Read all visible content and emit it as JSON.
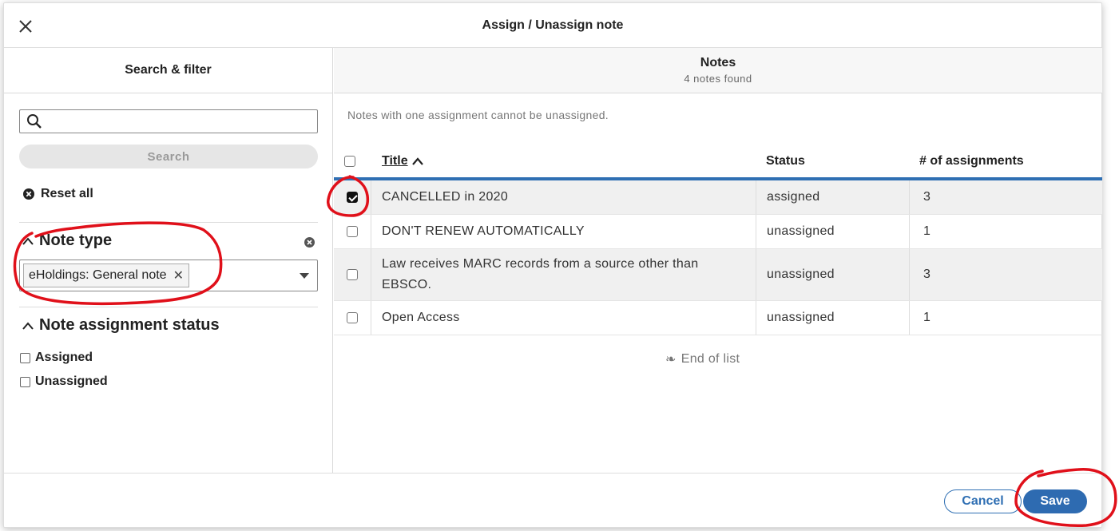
{
  "modal": {
    "title": "Assign / Unassign note",
    "close_icon": "close-icon"
  },
  "left_pane": {
    "title": "Search & filter",
    "search_placeholder": "",
    "search_button": "Search",
    "reset_all": "Reset all",
    "filters": [
      {
        "name": "Note type",
        "selected_tags": [
          "eHoldings: General note"
        ]
      },
      {
        "name": "Note assignment status",
        "options": [
          "Assigned",
          "Unassigned"
        ]
      }
    ]
  },
  "right_pane": {
    "title": "Notes",
    "subtitle": "4 notes found",
    "notice": "Notes with one assignment cannot be unassigned.",
    "columns": [
      "Title",
      "Status",
      "# of assignments"
    ],
    "rows": [
      {
        "title": "CANCELLED in 2020",
        "status": "assigned",
        "count": "3",
        "checked": true
      },
      {
        "title": "DON'T RENEW AUTOMATICALLY",
        "status": "unassigned",
        "count": "1",
        "checked": false
      },
      {
        "title": "Law receives MARC records from a source other than EBSCO.",
        "status": "unassigned",
        "count": "3",
        "checked": false
      },
      {
        "title": "Open Access",
        "status": "unassigned",
        "count": "1",
        "checked": false
      }
    ],
    "end_of_list": "End of list"
  },
  "footer": {
    "cancel": "Cancel",
    "save": "Save"
  },
  "colors": {
    "accent": "#2e6bb1",
    "annotation": "#e0101a"
  }
}
